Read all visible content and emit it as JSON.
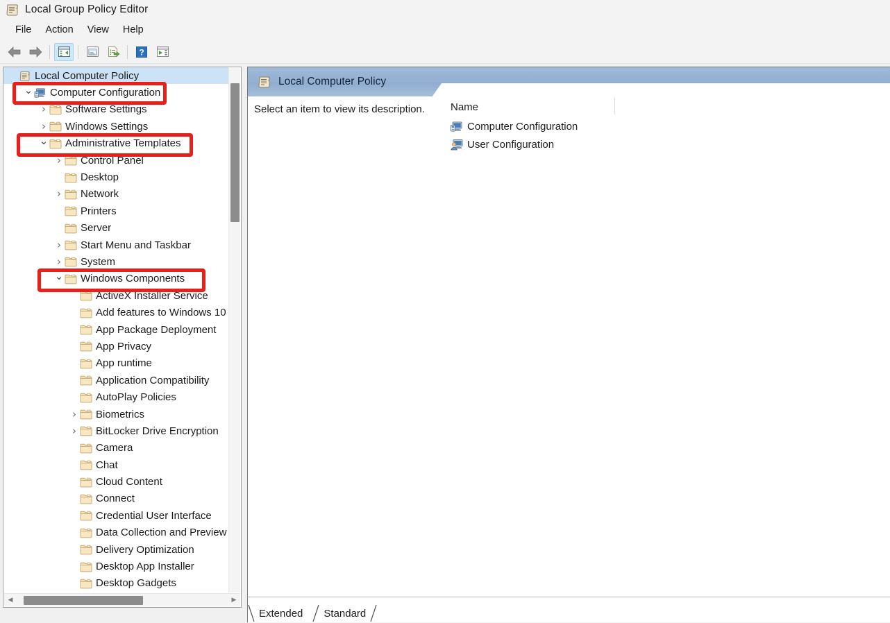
{
  "window": {
    "title": "Local Group Policy Editor",
    "icon": "group-policy-scroll-icon"
  },
  "menu": {
    "items": [
      {
        "label": "File"
      },
      {
        "label": "Action"
      },
      {
        "label": "View"
      },
      {
        "label": "Help"
      }
    ]
  },
  "toolbar": {
    "buttons": [
      {
        "name": "back-button",
        "icon": "left-arrow-icon"
      },
      {
        "name": "forward-button",
        "icon": "right-arrow-icon"
      },
      {
        "name": "show-hide-console-tree-button",
        "icon": "console-tree-icon"
      },
      {
        "name": "properties-button",
        "icon": "properties-window-icon"
      },
      {
        "name": "export-list-button",
        "icon": "export-list-icon"
      },
      {
        "name": "help-button",
        "icon": "question-mark-icon"
      },
      {
        "name": "show-hide-action-pane-button",
        "icon": "action-pane-icon"
      }
    ]
  },
  "tree": {
    "root": "Local Computer Policy",
    "items": [
      {
        "label": "Local Computer Policy",
        "depth": 0,
        "twisty": "",
        "icon": "policy-scroll-icon",
        "selected": true
      },
      {
        "label": "Computer Configuration",
        "depth": 1,
        "twisty": "open",
        "icon": "computer-config-icon",
        "selected": false
      },
      {
        "label": "Software Settings",
        "depth": 2,
        "twisty": "closed",
        "icon": "folder-icon",
        "selected": false
      },
      {
        "label": "Windows Settings",
        "depth": 2,
        "twisty": "closed",
        "icon": "folder-icon",
        "selected": false
      },
      {
        "label": "Administrative Templates",
        "depth": 2,
        "twisty": "open",
        "icon": "folder-icon",
        "selected": false
      },
      {
        "label": "Control Panel",
        "depth": 3,
        "twisty": "closed",
        "icon": "folder-icon",
        "selected": false
      },
      {
        "label": "Desktop",
        "depth": 3,
        "twisty": "",
        "icon": "folder-icon",
        "selected": false
      },
      {
        "label": "Network",
        "depth": 3,
        "twisty": "closed",
        "icon": "folder-icon",
        "selected": false
      },
      {
        "label": "Printers",
        "depth": 3,
        "twisty": "",
        "icon": "folder-icon",
        "selected": false
      },
      {
        "label": "Server",
        "depth": 3,
        "twisty": "",
        "icon": "folder-icon",
        "selected": false
      },
      {
        "label": "Start Menu and Taskbar",
        "depth": 3,
        "twisty": "closed",
        "icon": "folder-icon",
        "selected": false
      },
      {
        "label": "System",
        "depth": 3,
        "twisty": "closed",
        "icon": "folder-icon",
        "selected": false
      },
      {
        "label": "Windows Components",
        "depth": 3,
        "twisty": "open",
        "icon": "folder-icon",
        "selected": false
      },
      {
        "label": "ActiveX Installer Service",
        "depth": 4,
        "twisty": "",
        "icon": "folder-icon",
        "selected": false
      },
      {
        "label": "Add features to Windows 10",
        "depth": 4,
        "twisty": "",
        "icon": "folder-icon",
        "selected": false
      },
      {
        "label": "App Package Deployment",
        "depth": 4,
        "twisty": "",
        "icon": "folder-icon",
        "selected": false
      },
      {
        "label": "App Privacy",
        "depth": 4,
        "twisty": "",
        "icon": "folder-icon",
        "selected": false
      },
      {
        "label": "App runtime",
        "depth": 4,
        "twisty": "",
        "icon": "folder-icon",
        "selected": false
      },
      {
        "label": "Application Compatibility",
        "depth": 4,
        "twisty": "",
        "icon": "folder-icon",
        "selected": false
      },
      {
        "label": "AutoPlay Policies",
        "depth": 4,
        "twisty": "",
        "icon": "folder-icon",
        "selected": false
      },
      {
        "label": "Biometrics",
        "depth": 4,
        "twisty": "closed",
        "icon": "folder-icon",
        "selected": false
      },
      {
        "label": "BitLocker Drive Encryption",
        "depth": 4,
        "twisty": "closed",
        "icon": "folder-icon",
        "selected": false
      },
      {
        "label": "Camera",
        "depth": 4,
        "twisty": "",
        "icon": "folder-icon",
        "selected": false
      },
      {
        "label": "Chat",
        "depth": 4,
        "twisty": "",
        "icon": "folder-icon",
        "selected": false
      },
      {
        "label": "Cloud Content",
        "depth": 4,
        "twisty": "",
        "icon": "folder-icon",
        "selected": false
      },
      {
        "label": "Connect",
        "depth": 4,
        "twisty": "",
        "icon": "folder-icon",
        "selected": false
      },
      {
        "label": "Credential User Interface",
        "depth": 4,
        "twisty": "",
        "icon": "folder-icon",
        "selected": false
      },
      {
        "label": "Data Collection and Preview Builds",
        "depth": 4,
        "twisty": "",
        "icon": "folder-icon",
        "selected": false
      },
      {
        "label": "Delivery Optimization",
        "depth": 4,
        "twisty": "",
        "icon": "folder-icon",
        "selected": false
      },
      {
        "label": "Desktop App Installer",
        "depth": 4,
        "twisty": "",
        "icon": "folder-icon",
        "selected": false
      },
      {
        "label": "Desktop Gadgets",
        "depth": 4,
        "twisty": "",
        "icon": "folder-icon",
        "selected": false
      }
    ]
  },
  "details": {
    "header_title": "Local Computer Policy",
    "header_icon": "policy-scroll-icon",
    "description": "Select an item to view its description.",
    "column_header": "Name",
    "items": [
      {
        "label": "Computer Configuration",
        "icon": "computer-config-icon"
      },
      {
        "label": "User Configuration",
        "icon": "user-config-icon"
      }
    ]
  },
  "tabs": {
    "items": [
      {
        "label": "Extended",
        "active": false
      },
      {
        "label": "Standard",
        "active": true
      }
    ]
  },
  "annotations": {
    "boxes": [
      {
        "target": "Computer Configuration",
        "color": "#e8201a"
      },
      {
        "target": "Administrative Templates",
        "color": "#e8201a"
      },
      {
        "target": "Windows Components",
        "color": "#e8201a"
      }
    ]
  },
  "colors": {
    "accent_header": "#93b0d2",
    "selection": "#cce3f7",
    "annotation_red": "#e8201a",
    "toolbar_active": "#cde8f9"
  }
}
